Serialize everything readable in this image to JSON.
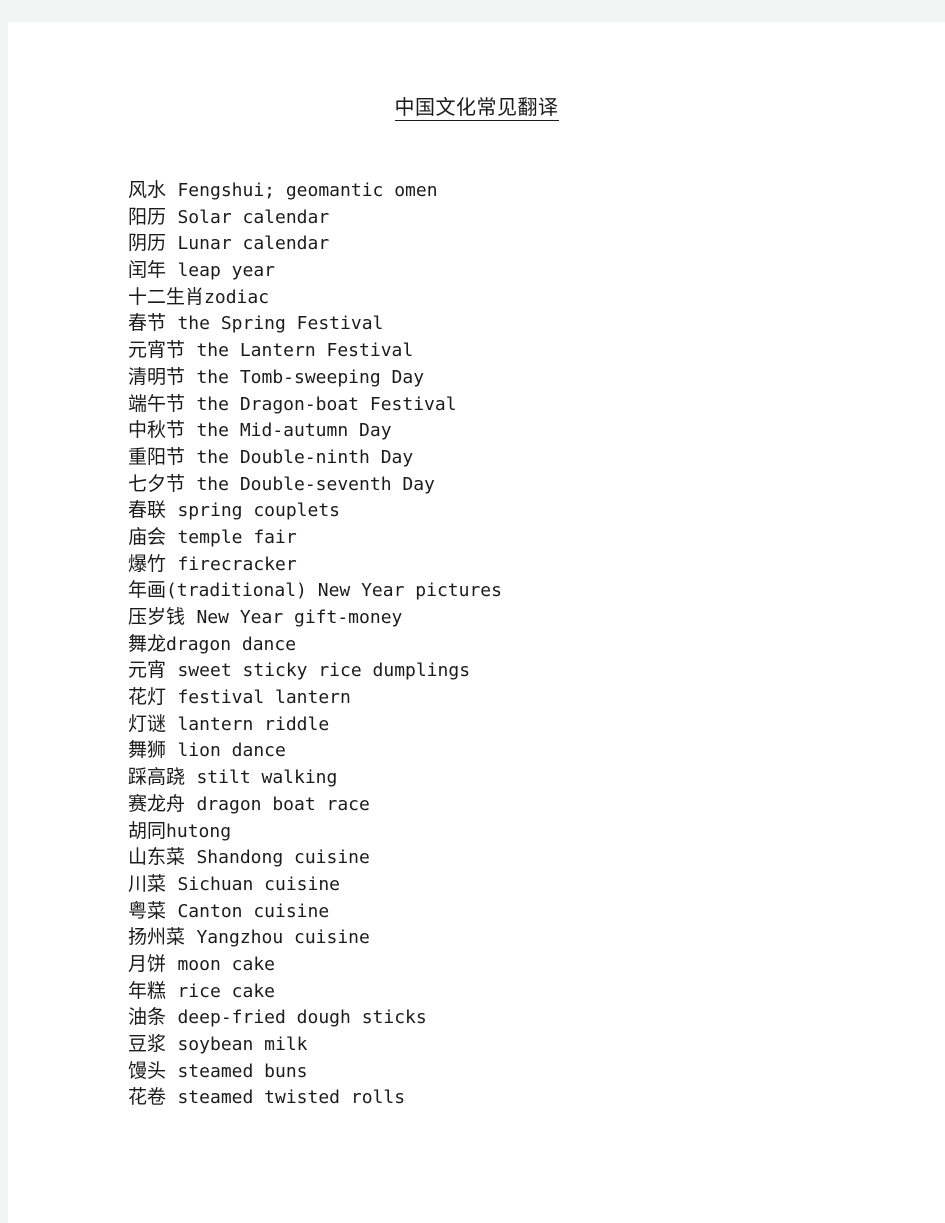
{
  "page": {
    "background_color": "#f3f4f4",
    "sheet_color": "#ffffff",
    "text_color": "#1b1b1b"
  },
  "title": {
    "text": "中国文化常见翻译",
    "underlined": true
  },
  "entries": [
    {
      "term": "风水",
      "sep": " ",
      "gloss": "Fengshui; geomantic omen"
    },
    {
      "term": "阳历",
      "sep": " ",
      "gloss": "Solar calendar"
    },
    {
      "term": "阴历",
      "sep": " ",
      "gloss": "Lunar calendar"
    },
    {
      "term": "闰年",
      "sep": " ",
      "gloss": "leap year"
    },
    {
      "term": "十二生肖",
      "sep": "",
      "gloss": "zodiac"
    },
    {
      "term": "春节",
      "sep": " ",
      "gloss": "the Spring Festival"
    },
    {
      "term": "元宵节",
      "sep": " ",
      "gloss": "the Lantern Festival"
    },
    {
      "term": "清明节",
      "sep": " ",
      "gloss": "the Tomb-sweeping Day"
    },
    {
      "term": "端午节",
      "sep": " ",
      "gloss": "the Dragon-boat Festival"
    },
    {
      "term": "中秋节",
      "sep": " ",
      "gloss": "the Mid-autumn Day"
    },
    {
      "term": "重阳节",
      "sep": " ",
      "gloss": "the Double-ninth Day"
    },
    {
      "term": "七夕节",
      "sep": " ",
      "gloss": "the Double-seventh Day"
    },
    {
      "term": "春联",
      "sep": " ",
      "gloss": "spring couplets"
    },
    {
      "term": "庙会",
      "sep": " ",
      "gloss": "temple fair"
    },
    {
      "term": "爆竹",
      "sep": " ",
      "gloss": "firecracker"
    },
    {
      "term": "年画",
      "sep": "",
      "gloss": "(traditional) New Year pictures"
    },
    {
      "term": "压岁钱",
      "sep": " ",
      "gloss": "New Year gift-money"
    },
    {
      "term": "舞龙",
      "sep": "",
      "gloss": "dragon dance"
    },
    {
      "term": "元宵",
      "sep": " ",
      "gloss": "sweet sticky rice dumplings"
    },
    {
      "term": "花灯",
      "sep": " ",
      "gloss": "festival lantern"
    },
    {
      "term": "灯谜",
      "sep": " ",
      "gloss": "lantern riddle"
    },
    {
      "term": "舞狮",
      "sep": " ",
      "gloss": "lion dance"
    },
    {
      "term": "踩高跷",
      "sep": " ",
      "gloss": "stilt walking"
    },
    {
      "term": "赛龙舟",
      "sep": " ",
      "gloss": "dragon boat race"
    },
    {
      "term": "胡同",
      "sep": "",
      "gloss": "hutong"
    },
    {
      "term": "山东菜",
      "sep": " ",
      "gloss": "Shandong cuisine"
    },
    {
      "term": "川菜",
      "sep": " ",
      "gloss": "Sichuan cuisine"
    },
    {
      "term": "粤菜",
      "sep": " ",
      "gloss": "Canton cuisine"
    },
    {
      "term": "扬州菜",
      "sep": " ",
      "gloss": "Yangzhou cuisine"
    },
    {
      "term": "月饼",
      "sep": " ",
      "gloss": "moon cake"
    },
    {
      "term": "年糕",
      "sep": " ",
      "gloss": "rice cake"
    },
    {
      "term": "油条",
      "sep": " ",
      "gloss": "deep-fried dough sticks"
    },
    {
      "term": "豆浆",
      "sep": " ",
      "gloss": "soybean milk"
    },
    {
      "term": "馒头",
      "sep": " ",
      "gloss": "steamed buns"
    },
    {
      "term": "花卷",
      "sep": " ",
      "gloss": "steamed twisted rolls"
    }
  ]
}
